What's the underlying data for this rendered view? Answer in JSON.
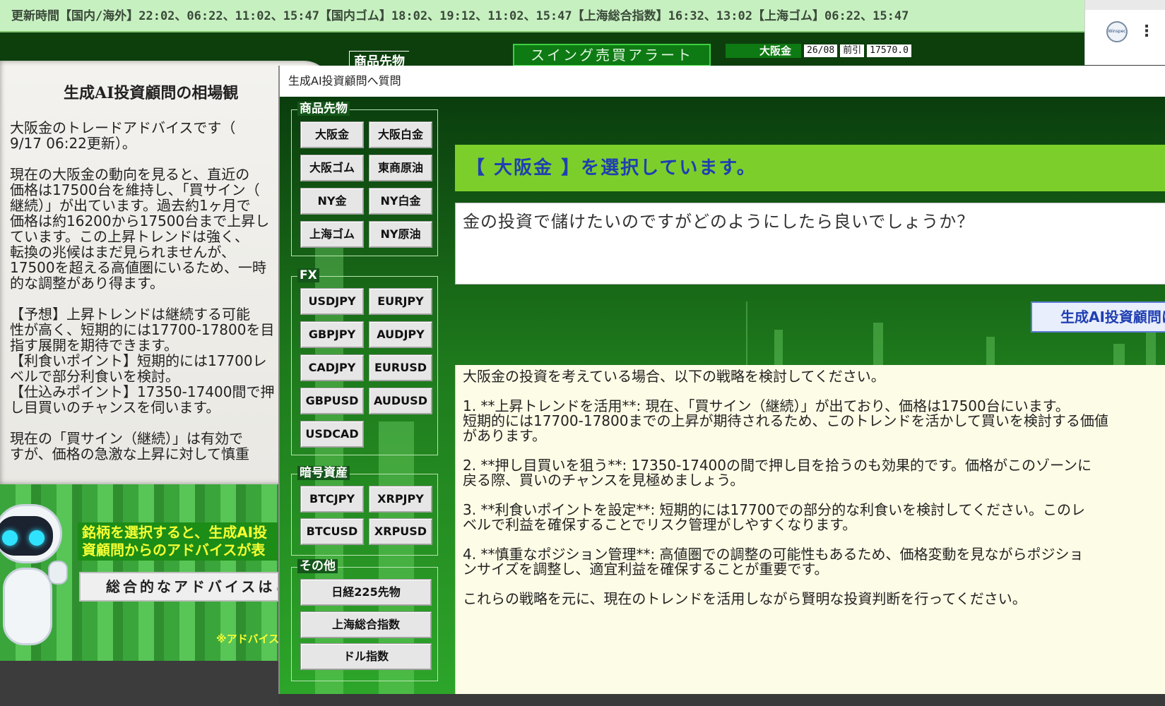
{
  "update_bar": {
    "text": "更新時間【国内/海外】22:02、06:22、11:02、15:47【国内ゴム】18:02、19:12、11:02、15:47【上海総合指数】16:32、13:02【上海ゴム】06:22、15:47"
  },
  "header": {
    "logo_text": "Winspec",
    "commodity_label": "商品先物",
    "swing_alert_label": "スイング売買アラート",
    "ticker": {
      "name": "大阪金",
      "date": "26/08",
      "session": "前引",
      "price": "17570.0"
    }
  },
  "outlook": {
    "title": "生成AI投資顧問の相場観",
    "text": "大阪金のトレードアドバイスです（\n9/17 06:22更新）。\n\n現在の大阪金の動向を見ると、直近の\n価格は17500台を維持し、「買サイン（\n継続）」が出ています。過去約1ヶ月で\n価格は約16200から17500台まで上昇し\nています。この上昇トレンドは強く、\n転換の兆候はまだ見られませんが、\n17500を超える高値圏にいるため、一時\n的な調整があり得ます。\n\n【予想】上昇トレンドは継続する可能\n性が高く、短期的には17700-17800を目\n指す展開を期待できます。\n【利食いポイント】短期的には17700レ\nベルで部分利食いを検討。\n【仕込みポイント】17350-17400間で押\nし目買いのチャンスを伺います。\n\n現在の「買サイン（継続）」は有効で\nすが、価格の急激な上昇に対して慎重"
  },
  "banner": {
    "message": "銘柄を選択すると、生成AI投資顧問からのアドバイスが表示されます。",
    "overall_button": "総合的なアドバイスはこちら",
    "note": "※アドバイス"
  },
  "dialog": {
    "title": "生成AI投資顧問へ質問",
    "groups": {
      "commodity": {
        "label": "商品先物",
        "items": [
          "大阪金",
          "大阪白金",
          "大阪ゴム",
          "東商原油",
          "NY金",
          "NY白金",
          "上海ゴム",
          "NY原油"
        ]
      },
      "fx": {
        "label": "FX",
        "items": [
          "USDJPY",
          "EURJPY",
          "GBPJPY",
          "AUDJPY",
          "CADJPY",
          "EURUSD",
          "GBPUSD",
          "AUDUSD",
          "USDCAD"
        ]
      },
      "crypto": {
        "label": "暗号資産",
        "items": [
          "BTCJPY",
          "XRPJPY",
          "BTCUSD",
          "XRPUSD"
        ]
      },
      "other": {
        "label": "その他",
        "items": [
          "日経225先物",
          "上海総合指数",
          "ドル指数"
        ]
      }
    },
    "selection_text": "【 大阪金 】を選択しています。",
    "question": "金の投資で儲けたいのですがどのようにしたら良いでしょうか？",
    "ask_button": "生成AI投資顧問に質問",
    "answer": "大阪金の投資を考えている場合、以下の戦略を検討してください。\n\n1. **上昇トレンドを活用**: 現在、「買サイン（継続）」が出ており、価格は17500台にいます。\n短期的には17700-17800までの上昇が期待されるため、このトレンドを活かして買いを検討する価値\nがあります。\n\n2. **押し目買いを狙う**: 17350-17400の間で押し目を拾うのも効果的です。価格がこのゾーンに\n戻る際、買いのチャンスを見極めましょう。\n\n3. **利食いポイントを設定**: 短期的には17700での部分的な利食いを検討してください。このレ\nベルで利益を確保することでリスク管理がしやすくなります。\n\n4. **慎重なポジション管理**: 高値圏での調整の可能性もあるため、価格変動を見ながらポジショ\nンサイズを調整し、適宜利益を確保することが重要です。\n\nこれらの戦略を元に、現在のトレンドを活用しながら賢明な投資判断を行ってください。"
  },
  "colors": {
    "selection_banner": "#7ccf2b",
    "selection_text": "#1f3fb2",
    "banner_message": "#f5ff33",
    "answer_background": "#fdfce6"
  }
}
